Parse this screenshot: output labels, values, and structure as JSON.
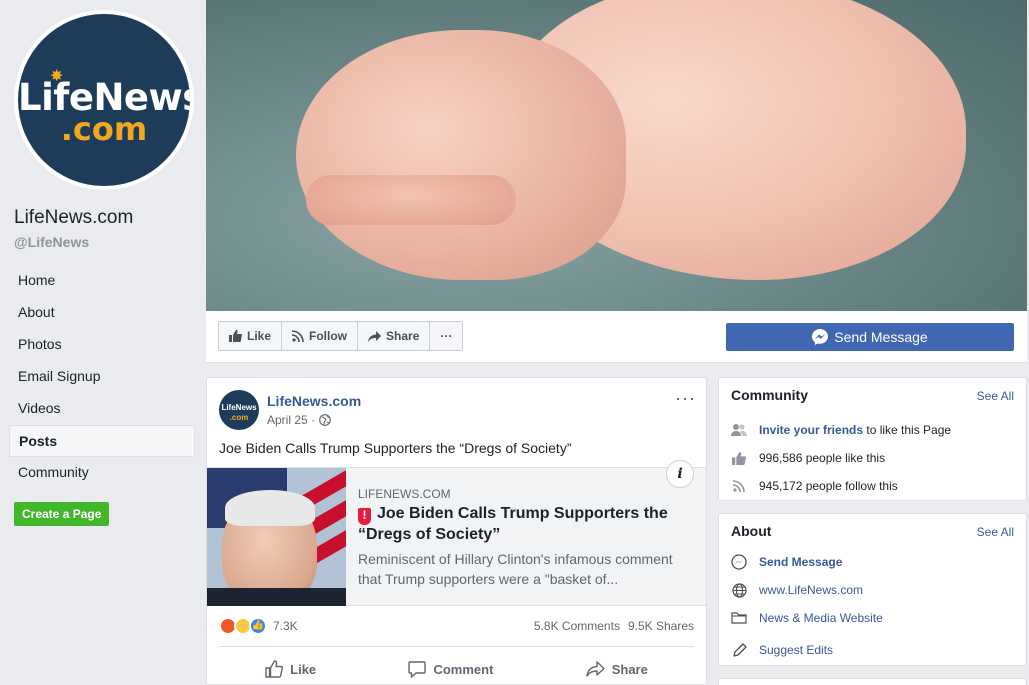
{
  "page": {
    "logo_text_1": "LifeNews",
    "logo_text_2": ".com",
    "name": "LifeNews.com",
    "handle": "@LifeNews"
  },
  "nav": {
    "items": [
      {
        "label": "Home"
      },
      {
        "label": "About"
      },
      {
        "label": "Photos"
      },
      {
        "label": "Email Signup"
      },
      {
        "label": "Videos"
      },
      {
        "label": "Posts",
        "active": true
      },
      {
        "label": "Community"
      }
    ],
    "create_page": "Create a Page"
  },
  "actions": {
    "like": "Like",
    "follow": "Follow",
    "share": "Share",
    "more": "···",
    "send_message": "Send Message"
  },
  "post": {
    "author": "LifeNews.com",
    "date": "April 25 ·",
    "more": "···",
    "text": "Joe Biden Calls Trump Supporters the “Dregs of Society”",
    "avatar_text_1": "LifeNews",
    "avatar_text_2": ".com",
    "link": {
      "domain": "LIFENEWS.COM",
      "title": "Joe Biden Calls Trump Supporters the “Dregs of Society”",
      "description": "Reminiscent of Hillary Clinton's infamous comment that Trump supporters were a \"basket of...",
      "info": "i"
    },
    "reaction_count": "7.3K",
    "comments": "5.8K Comments",
    "shares": "9.5K Shares",
    "buttons": {
      "like": "Like",
      "comment": "Comment",
      "share": "Share"
    }
  },
  "community": {
    "title": "Community",
    "see_all": "See All",
    "invite_link": "Invite your friends",
    "invite_rest": " to like this Page",
    "likes": "996,586 people like this",
    "follows": "945,172 people follow this"
  },
  "about": {
    "title": "About",
    "see_all": "See All",
    "send_message": "Send Message",
    "website": "www.LifeNews.com",
    "category": "News & Media Website",
    "suggest": "Suggest Edits"
  },
  "colors": {
    "brand_blue": "#4267b2",
    "link_blue": "#385898",
    "create_green": "#42b72a",
    "logo_navy": "#1d3c5a",
    "logo_orange": "#f2a81d"
  }
}
